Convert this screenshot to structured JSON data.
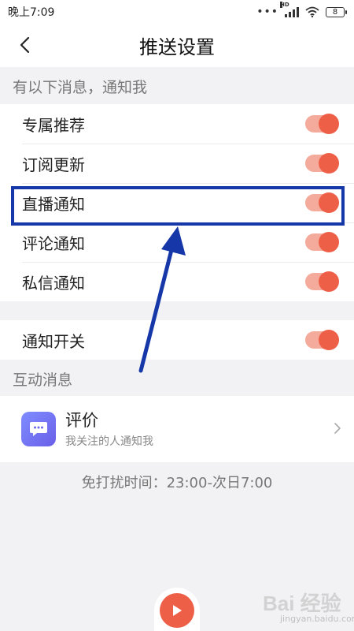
{
  "status_bar": {
    "time": "晚上7:09",
    "battery": "8",
    "network": "HD"
  },
  "nav": {
    "title": "推送设置"
  },
  "section_notify": {
    "header": "有以下消息，通知我",
    "items": [
      {
        "label": "专属推荐",
        "enabled": true
      },
      {
        "label": "订阅更新",
        "enabled": true
      },
      {
        "label": "直播通知",
        "enabled": true
      },
      {
        "label": "评论通知",
        "enabled": true
      },
      {
        "label": "私信通知",
        "enabled": true
      }
    ]
  },
  "master_switch": {
    "label": "通知开关",
    "enabled": true
  },
  "section_interaction": {
    "header": "互动消息",
    "review": {
      "title": "评价",
      "subtitle": "我关注的人通知我"
    }
  },
  "quiet_time": "免打扰时间：23:00-次日7:00",
  "watermark": {
    "brand": "Bai 经验",
    "url": "jingyan.baidu.com"
  },
  "colors": {
    "accent": "#ee5f48",
    "toggle_track": "#f4ab9b",
    "highlight": "#1537a8",
    "review_icon": "#7a7cf8"
  }
}
